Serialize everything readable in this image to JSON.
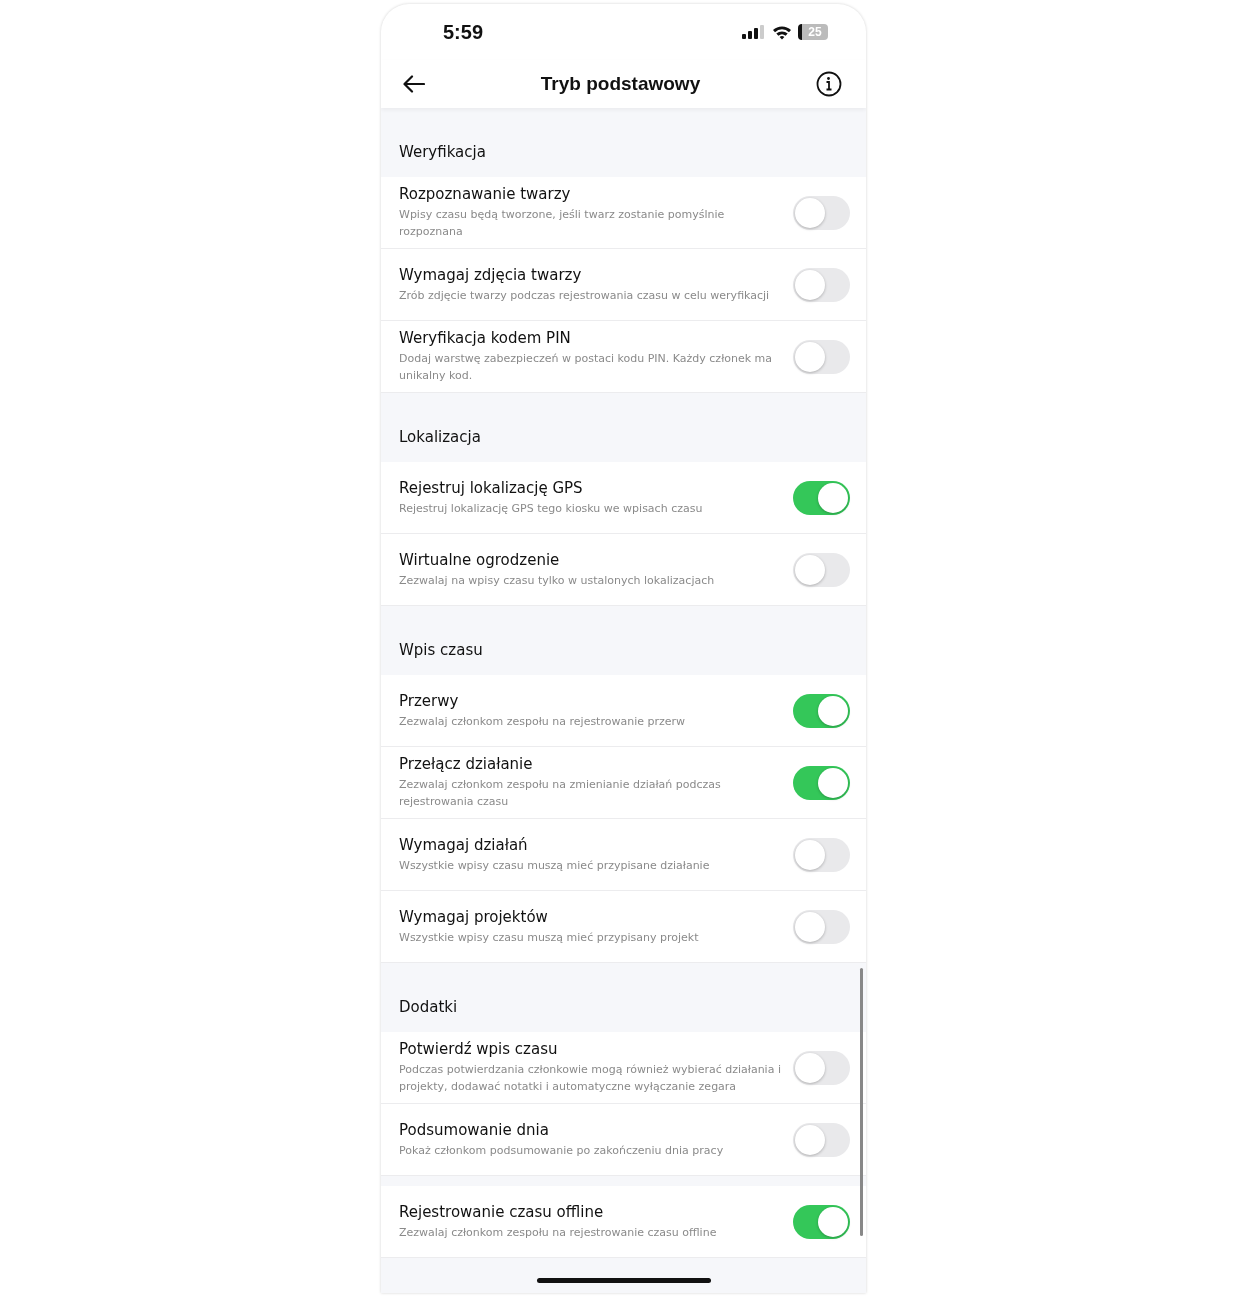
{
  "status_bar": {
    "time": "5:59",
    "battery": "25"
  },
  "header": {
    "title": "Tryb podstawowy"
  },
  "sections": [
    {
      "title": "Weryfikacja",
      "items": [
        {
          "title": "Rozpoznawanie twarzy",
          "description": "Wpisy czasu będą tworzone, jeśli twarz zostanie pomyślnie rozpoznana",
          "on": false
        },
        {
          "title": "Wymagaj zdjęcia twarzy",
          "description": "Zrób zdjęcie twarzy podczas rejestrowania czasu w celu weryfikacji",
          "on": false
        },
        {
          "title": "Weryfikacja kodem PIN",
          "description": "Dodaj warstwę zabezpieczeń w postaci kodu PIN. Każdy członek ma unikalny kod.",
          "on": false
        }
      ]
    },
    {
      "title": "Lokalizacja",
      "items": [
        {
          "title": "Rejestruj lokalizację GPS",
          "description": "Rejestruj lokalizację GPS tego kiosku we wpisach czasu",
          "on": true
        },
        {
          "title": "Wirtualne ogrodzenie",
          "description": "Zezwalaj na wpisy czasu tylko w ustalonych lokalizacjach",
          "on": false
        }
      ]
    },
    {
      "title": "Wpis czasu",
      "items": [
        {
          "title": "Przerwy",
          "description": "Zezwalaj członkom zespołu na rejestrowanie przerw",
          "on": true
        },
        {
          "title": "Przełącz działanie",
          "description": "Zezwalaj członkom zespołu na zmienianie działań podczas rejestrowania czasu",
          "on": true
        },
        {
          "title": "Wymagaj działań",
          "description": "Wszystkie wpisy czasu muszą mieć przypisane działanie",
          "on": false
        },
        {
          "title": "Wymagaj projektów",
          "description": "Wszystkie wpisy czasu muszą mieć przypisany projekt",
          "on": false
        }
      ]
    },
    {
      "title": "Dodatki",
      "items": [
        {
          "title": "Potwierdź wpis czasu",
          "description": "Podczas potwierdzania członkowie mogą również wybierać działania i projekty, dodawać notatki i automatyczne wyłączanie zegara",
          "on": false
        },
        {
          "title": "Podsumowanie dnia",
          "description": "Pokaż członkom podsumowanie po zakończeniu dnia pracy",
          "on": false
        }
      ]
    },
    {
      "items": [
        {
          "title": "Rejestrowanie czasu offline",
          "description": "Zezwalaj członkom zespołu na rejestrowanie czasu offline",
          "on": true
        }
      ]
    }
  ]
}
